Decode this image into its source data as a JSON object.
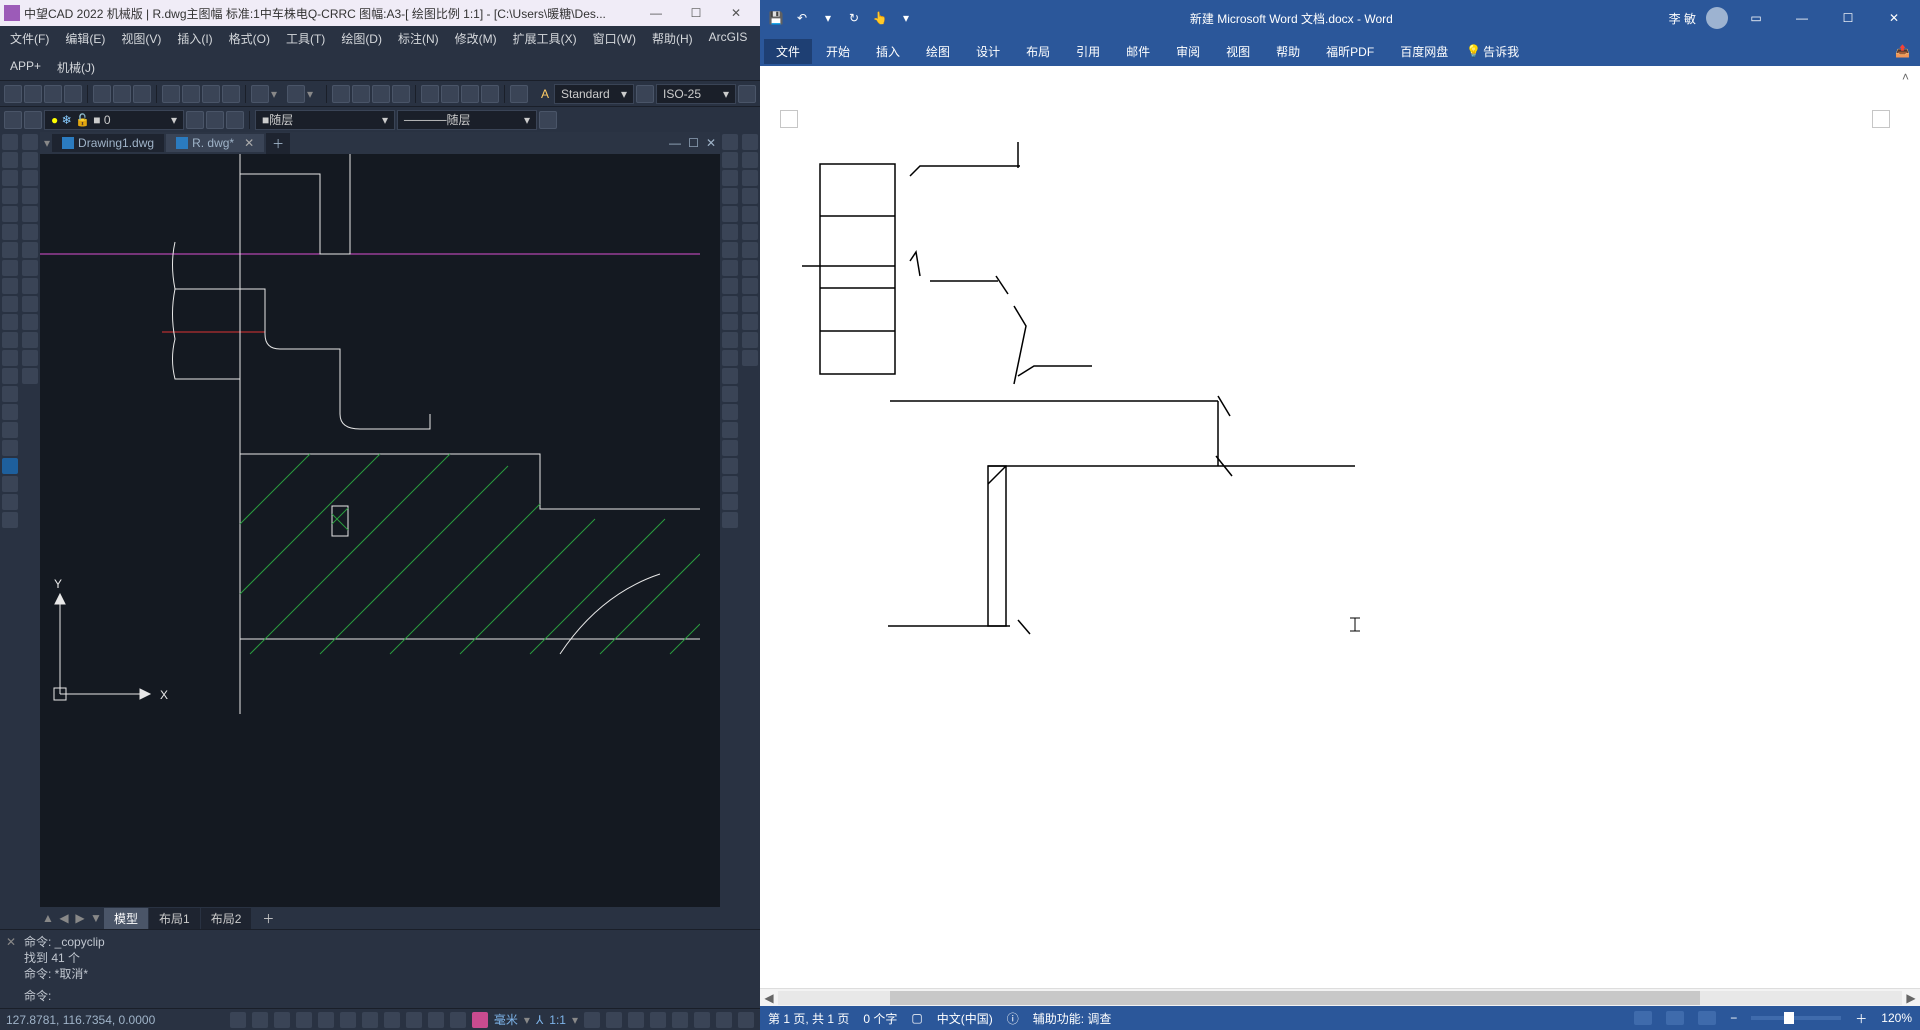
{
  "cad": {
    "title": "中望CAD 2022 机械版 | R.dwg主图幅  标准:1中车株电Q-CRRC 图幅:A3-[ 绘图比例 1:1] - [C:\\Users\\暖糖\\Des...",
    "menus": [
      "文件(F)",
      "编辑(E)",
      "视图(V)",
      "插入(I)",
      "格式(O)",
      "工具(T)",
      "绘图(D)",
      "标注(N)",
      "修改(M)",
      "扩展工具(X)",
      "窗口(W)",
      "帮助(H)",
      "ArcGIS",
      "APP+",
      "机械(J)"
    ],
    "style_combo": "Standard",
    "dim_combo": "ISO-25",
    "layer_value": "0",
    "layer_color_combo": "随层",
    "layer_lt_combo": "随层",
    "tabs": [
      {
        "label": "Drawing1.dwg",
        "active": false
      },
      {
        "label": "R. dwg*",
        "active": true
      }
    ],
    "layout_tabs": {
      "model": "模型",
      "layout1": "布局1",
      "layout2": "布局2"
    },
    "axis": {
      "x": "X",
      "y": "Y"
    },
    "cmd_lines": [
      "命令: _copyclip",
      "找到 41 个",
      "命令: *取消*"
    ],
    "cmd_prompt": "命令:",
    "status_coords": "127.8781, 116.7354, 0.0000",
    "status_unit": "毫米",
    "status_scale": "1:1"
  },
  "word": {
    "doc_title": "新建 Microsoft Word 文档.docx - Word",
    "user": "李 敏",
    "ribbon": [
      "文件",
      "开始",
      "插入",
      "绘图",
      "设计",
      "布局",
      "引用",
      "邮件",
      "审阅",
      "视图",
      "帮助",
      "福昕PDF",
      "百度网盘"
    ],
    "tell_me": "告诉我",
    "status": {
      "page": "第 1 页, 共 1 页",
      "words": "0 个字",
      "lang": "中文(中国)",
      "acc": "辅助功能: 调查",
      "zoom": "120%"
    }
  }
}
